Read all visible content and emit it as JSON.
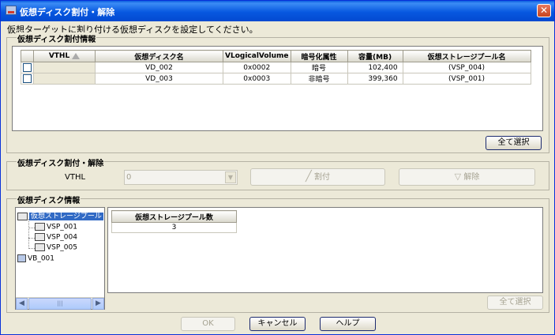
{
  "window": {
    "title": "仮想ディスク割付・解除"
  },
  "instruction": "仮想ターゲットに割り付ける仮想ディスクを設定してください。",
  "assign_info": {
    "group_title": "仮想ディスク割付情報",
    "columns": [
      "VTHL",
      "仮想ディスク名",
      "VLogicalVolume",
      "暗号化属性",
      "容量(MB)",
      "仮想ストレージプール名"
    ],
    "rows": [
      {
        "vthl": "",
        "name": "VD_002",
        "vlv": "0x0002",
        "enc": "暗号",
        "cap": "102,400",
        "pool": "(VSP_004)"
      },
      {
        "vthl": "",
        "name": "VD_003",
        "vlv": "0x0003",
        "enc": "非暗号",
        "cap": "399,360",
        "pool": "(VSP_001)"
      }
    ],
    "select_all": "全て選択"
  },
  "assign_release": {
    "group_title": "仮想ディスク割付・解除",
    "vthl_label": "VTHL",
    "vthl_value": "0",
    "assign_button": "割付",
    "release_button": "解除"
  },
  "disk_info": {
    "group_title": "仮想ディスク情報",
    "tree": {
      "root": "仮想ストレージプール",
      "children": [
        "VSP_001",
        "VSP_004",
        "VSP_005"
      ],
      "other": "VB_001"
    },
    "table_header": "仮想ストレージプール数",
    "table_value": "3",
    "select_all": "全て選択"
  },
  "footer": {
    "ok": "OK",
    "cancel": "キャンセル",
    "help": "ヘルプ"
  }
}
